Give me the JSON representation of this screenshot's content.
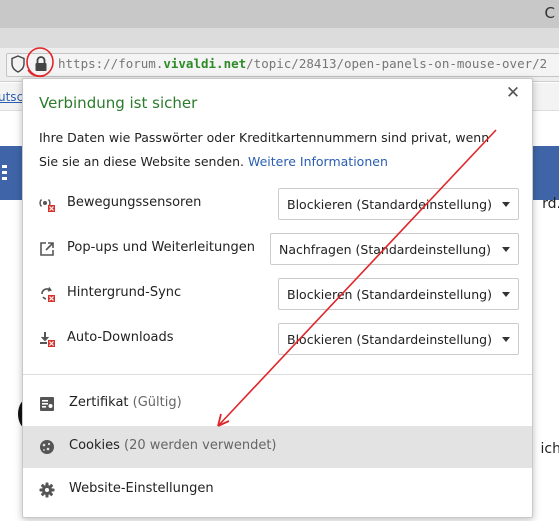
{
  "browser": {
    "corner_glyph": "C",
    "url_prefix": "https://forum.",
    "url_domain": "vivaldi.net",
    "url_path": "/topic/28413/open-panels-on-mouse-over/2",
    "bookmark_fragment": "utsc"
  },
  "page_behind": {
    "fragment_1": "rd.",
    "fragment_2": "ich"
  },
  "popup": {
    "title": "Verbindung ist sicher",
    "description": "Ihre Daten wie Passwörter oder Kreditkartennummern sind privat, wenn Sie sie an diese Website senden.",
    "more_info_link": "Weitere Informationen",
    "permissions": [
      {
        "icon": "motion-sensor-blocked-icon",
        "label": "Bewegungssensoren",
        "value": "Blockieren (Standardeinstellung)"
      },
      {
        "icon": "popup-redirect-icon",
        "label": "Pop-ups und Weiterleitungen",
        "value": "Nachfragen (Standardeinstellung)"
      },
      {
        "icon": "background-sync-blocked-icon",
        "label": "Hintergrund-Sync",
        "value": "Blockieren (Standardeinstellung)"
      },
      {
        "icon": "auto-download-blocked-icon",
        "label": "Auto-Downloads",
        "value": "Blockieren (Standardeinstellung)"
      }
    ],
    "menu": [
      {
        "icon": "certificate-icon",
        "label": "Zertifikat",
        "note": "(Gültig)"
      },
      {
        "icon": "cookie-icon",
        "label": "Cookies",
        "note": "(20 werden verwendet)"
      },
      {
        "icon": "gear-icon",
        "label": "Website-Einstellungen",
        "note": ""
      }
    ]
  },
  "colors": {
    "title_green": "#2c7a2c",
    "link_blue": "#2a5db0",
    "annotation_red": "#e0262a",
    "site_bar_blue": "#3f65a8"
  }
}
